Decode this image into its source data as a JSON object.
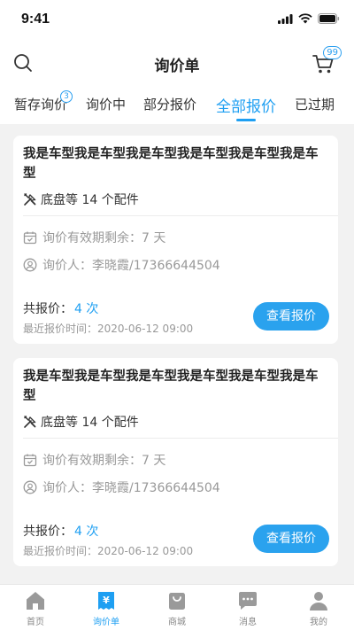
{
  "status_bar": {
    "time": "9:41"
  },
  "header": {
    "title": "询价单",
    "cart_badge": "99"
  },
  "tabs": [
    {
      "label": "暂存询价",
      "badge": "3",
      "active": false
    },
    {
      "label": "询价中",
      "active": false
    },
    {
      "label": "部分报价",
      "active": false
    },
    {
      "label": "全部报价",
      "active": true
    },
    {
      "label": "已过期",
      "active": false
    }
  ],
  "cards": [
    {
      "title": "我是车型我是车型我是车型我是车型我是车型我是车型",
      "parts": "底盘等 14 个配件",
      "validity": "询价有效期剩余：7 天",
      "inquirer": "询价人：李晓霞/17366644504",
      "quote_count_label": "共报价：",
      "quote_count_value": "4 次",
      "recent_quote_time": "最近报价时间：2020-06-12  09:00",
      "button_label": "查看报价"
    },
    {
      "title": "我是车型我是车型我是车型我是车型我是车型我是车型",
      "parts": "底盘等 14 个配件",
      "validity": "询价有效期剩余：7 天",
      "inquirer": "询价人：李晓霞/17366644504",
      "quote_count_label": "共报价：",
      "quote_count_value": "4 次",
      "recent_quote_time": "最近报价时间：2020-06-12  09:00",
      "button_label": "查看报价"
    }
  ],
  "bottom_nav": [
    {
      "label": "首页",
      "icon": "home-icon",
      "active": false
    },
    {
      "label": "询价单",
      "icon": "inquiry-icon",
      "active": true
    },
    {
      "label": "商城",
      "icon": "shop-bag-icon",
      "active": false
    },
    {
      "label": "消息",
      "icon": "message-icon",
      "active": false
    },
    {
      "label": "我的",
      "icon": "profile-icon",
      "active": false
    }
  ],
  "colors": {
    "accent": "#1e9ff2",
    "inactive_icon": "#9a9a9a"
  }
}
